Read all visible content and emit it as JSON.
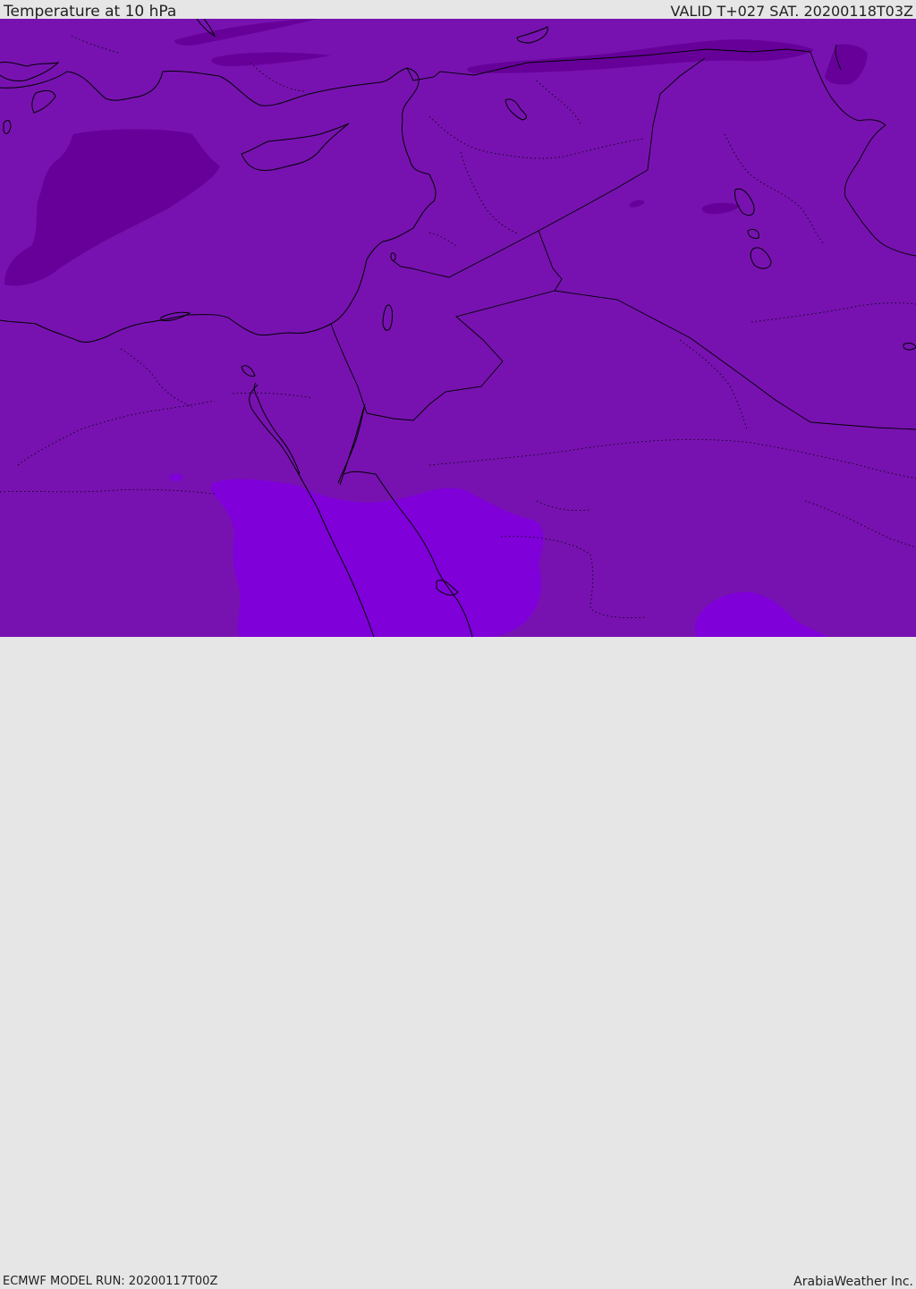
{
  "header": {
    "title": "Temperature at 10 hPa",
    "valid_time": "VALID T+027 SAT. 20200118T03Z"
  },
  "footer": {
    "model_run": "ECMWF MODEL RUN: 20200117T00Z",
    "credit": "ArabiaWeather Inc."
  },
  "map": {
    "colors": {
      "base_field": "#7712b0",
      "cold_patch": "#660099",
      "warm_patch": "#7f00d9",
      "coastline": "#000000",
      "borders_dotted": "#000000"
    }
  }
}
